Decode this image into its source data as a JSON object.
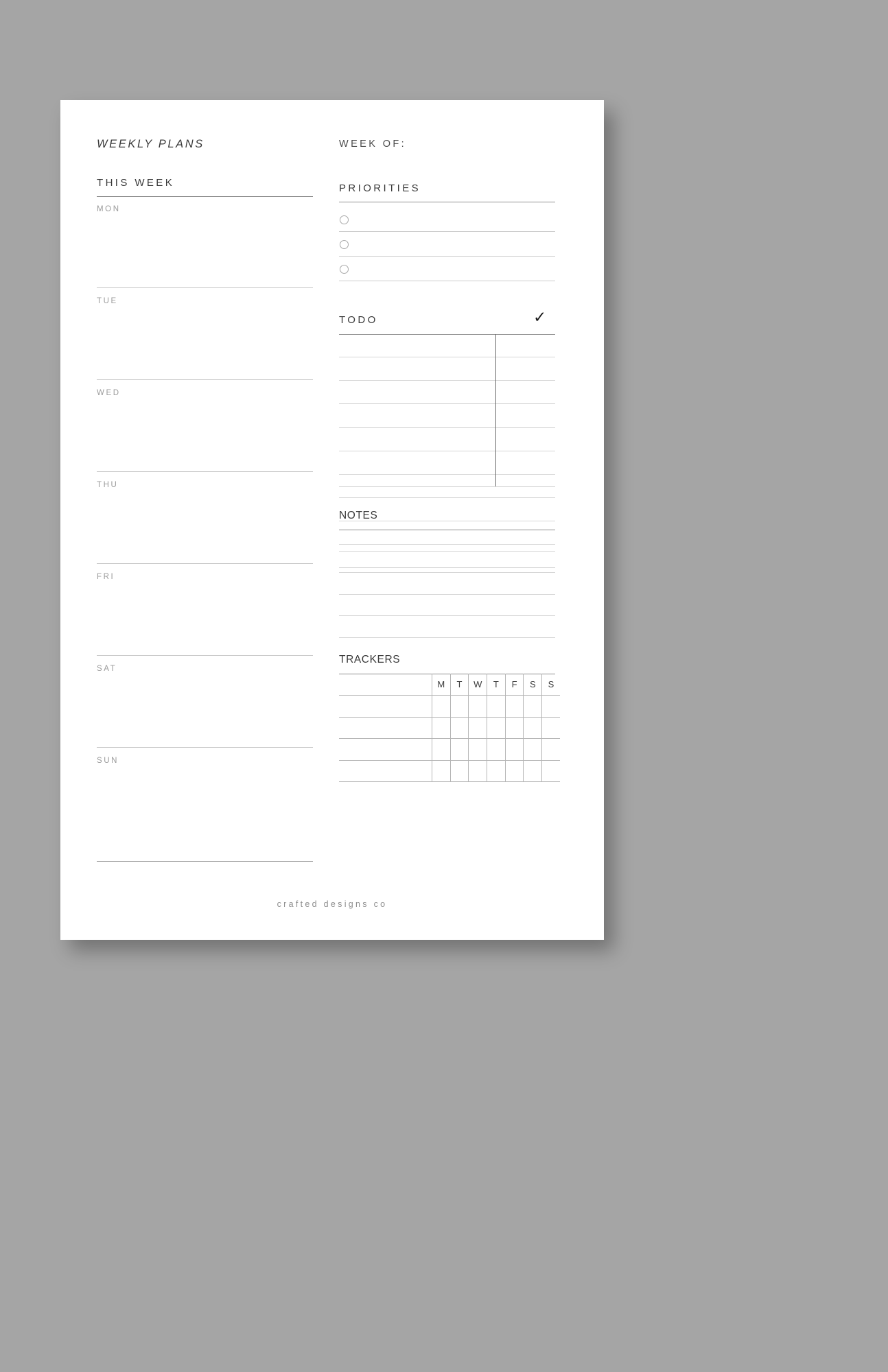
{
  "document": {
    "title": "WEEKLY PLANS",
    "week_of_label": "WEEK OF:",
    "footer": "crafted designs co"
  },
  "left": {
    "section_title": "THIS WEEK",
    "days": [
      {
        "label": "MON"
      },
      {
        "label": "TUE"
      },
      {
        "label": "WED"
      },
      {
        "label": "THU"
      },
      {
        "label": "FRI"
      },
      {
        "label": "SAT"
      },
      {
        "label": "SUN"
      }
    ]
  },
  "right": {
    "priorities": {
      "title": "PRIORITIES",
      "rows": 3
    },
    "todo": {
      "title": "TODO",
      "check_icon": "✓",
      "rows": 11
    },
    "notes": {
      "title": "NOTES",
      "rows": 5
    },
    "trackers": {
      "title": "TRACKERS",
      "name_column_header": "",
      "day_headers": [
        "M",
        "T",
        "W",
        "T",
        "F",
        "S",
        "S"
      ],
      "body_rows": 4
    }
  },
  "colors": {
    "page_background": "#a5a5a5",
    "sheet": "#ffffff",
    "ink_dark": "#3a3a3a",
    "ink_muted": "#9a9a9a",
    "rule_strong": "#8d8d8d",
    "rule_light": "#d2d2d2",
    "table_border": "#b5b5b5"
  }
}
